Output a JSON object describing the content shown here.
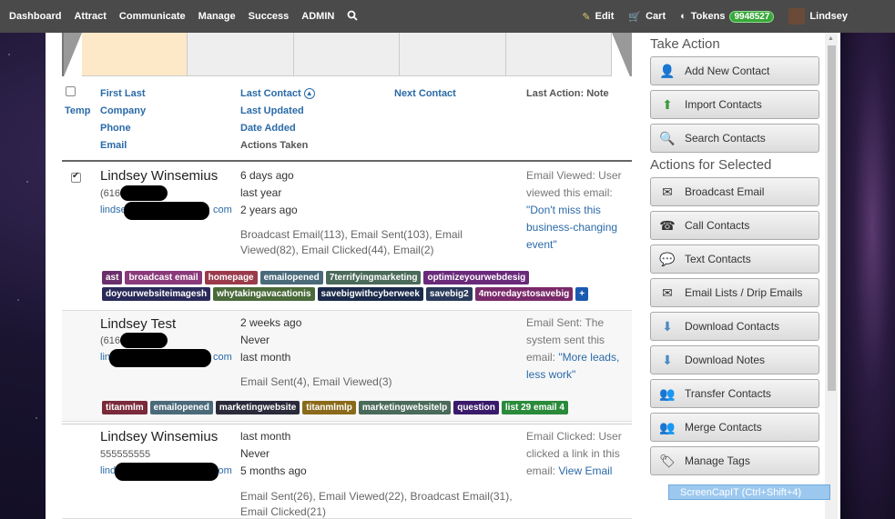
{
  "nav": {
    "items": [
      "Dashboard",
      "Attract",
      "Communicate",
      "Manage",
      "Success",
      "ADMIN"
    ],
    "edit": "Edit",
    "cart": "Cart",
    "tokens_label": "Tokens",
    "tokens_value": "9948527",
    "user": "Lindsey"
  },
  "list_header": {
    "temp": "Temp",
    "col1": [
      "First Last",
      "Company",
      "Phone",
      "Email"
    ],
    "col2": [
      "Last Contact",
      "Last Updated",
      "Date Added",
      "Actions Taken"
    ],
    "col3": "Next Contact",
    "col4": "Last Action: Note"
  },
  "rows": [
    {
      "name": "Lindsey  Winsemius",
      "phone": "(616",
      "email_prefix": "lindse",
      "email_suffix": "com",
      "dates": [
        "6 days ago",
        "last year",
        "2 years ago"
      ],
      "actions": "Broadcast Email(113), Email Sent(103), Email Viewed(82), Email Clicked(44), Email(2)",
      "note_text": "Email Viewed: User viewed this email: ",
      "note_link": "\"Don't miss this business-changing event\"",
      "tags": [
        {
          "label": "ast",
          "color": "#6b2f6b"
        },
        {
          "label": "broadcast email",
          "color": "#8a3a7a"
        },
        {
          "label": "homepage",
          "color": "#9a3a4a"
        },
        {
          "label": "emailopened",
          "color": "#4a6a7a"
        },
        {
          "label": "7terrifyingmarketing",
          "color": "#4a6a5a"
        },
        {
          "label": "optimizeyourwebdesig",
          "color": "#6a2a7a"
        },
        {
          "label": "doyourwebsiteimagesh",
          "color": "#2a2a5a"
        },
        {
          "label": "whytakingavacationis",
          "color": "#4a6a3a"
        },
        {
          "label": "savebigwithcyberweek",
          "color": "#1a2a4a"
        },
        {
          "label": "savebig2",
          "color": "#2a3a5a"
        },
        {
          "label": "4moredaystosavebig",
          "color": "#7a2a6a"
        },
        {
          "label": "+",
          "color": "#1a5ab0"
        }
      ]
    },
    {
      "name": "Lindsey  Test",
      "phone": "(616",
      "email_prefix": "lin",
      "email_suffix": "com",
      "dates": [
        "2 weeks ago",
        "Never",
        "last month"
      ],
      "actions": "Email Sent(4), Email Viewed(3)",
      "note_text": "Email Sent: The system sent this email: ",
      "note_link": "\"More leads, less work\"",
      "tags": [
        {
          "label": "titanmlm",
          "color": "#7a2a3a"
        },
        {
          "label": "emailopened",
          "color": "#4a6a7a"
        },
        {
          "label": "marketingwebsite",
          "color": "#2a2a3a"
        },
        {
          "label": "titanmlmlp",
          "color": "#8a6a1a"
        },
        {
          "label": "marketingwebsitelp",
          "color": "#4a6a5a"
        },
        {
          "label": "question",
          "color": "#3a1a6a"
        },
        {
          "label": "list 29 email 4",
          "color": "#2a8a3a"
        }
      ]
    },
    {
      "name": "Lindsey  Winsemius",
      "phone": "555555555",
      "email_prefix": "lind",
      "email_suffix": "com",
      "dates": [
        "last month",
        "Never",
        "5 months ago"
      ],
      "actions": "Email Sent(26), Email Viewed(22), Broadcast Email(31), Email Clicked(21)",
      "note_text": "Email Clicked: User clicked a link in this email: ",
      "note_link": "View Email",
      "tags": []
    }
  ],
  "take_action": {
    "title": "Take Action",
    "buttons": [
      "Add New Contact",
      "Import Contacts",
      "Search Contacts"
    ]
  },
  "actions_selected": {
    "title": "Actions for Selected",
    "buttons": [
      "Broadcast Email",
      "Call Contacts",
      "Text Contacts",
      "Email Lists / Drip Emails",
      "Download Contacts",
      "Download Notes",
      "Transfer Contacts",
      "Merge Contacts",
      "Manage Tags"
    ]
  },
  "screencap": "ScreenCapIT  (Ctrl+Shift+4)"
}
